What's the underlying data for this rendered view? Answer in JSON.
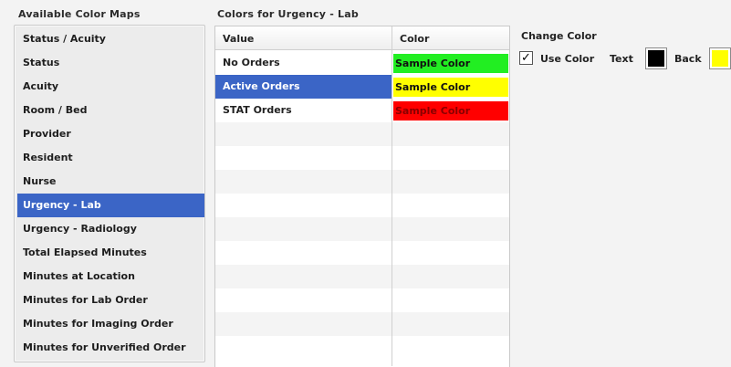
{
  "left_panel": {
    "title": "Available Color Maps",
    "items": [
      {
        "label": "Status / Acuity"
      },
      {
        "label": "Status"
      },
      {
        "label": "Acuity"
      },
      {
        "label": "Room / Bed"
      },
      {
        "label": "Provider"
      },
      {
        "label": "Resident"
      },
      {
        "label": "Nurse"
      },
      {
        "label": "Urgency - Lab"
      },
      {
        "label": "Urgency - Radiology"
      },
      {
        "label": "Total Elapsed Minutes"
      },
      {
        "label": "Minutes at Location"
      },
      {
        "label": "Minutes for Lab Order"
      },
      {
        "label": "Minutes for Imaging Order"
      },
      {
        "label": "Minutes for Unverified Order"
      }
    ],
    "selected_index": 7
  },
  "grid": {
    "title": "Colors for Urgency - Lab",
    "headers": {
      "value": "Value",
      "color": "Color"
    },
    "rows": [
      {
        "value": "No Orders",
        "sample": "Sample Color",
        "bg": "#22ee22",
        "fg": "#111111"
      },
      {
        "value": "Active Orders",
        "sample": "Sample Color",
        "bg": "#ffff00",
        "fg": "#111111"
      },
      {
        "value": "STAT Orders",
        "sample": "Sample Color",
        "bg": "#ff0000",
        "fg": "#8a0000"
      }
    ],
    "selected_row": 1
  },
  "change_color": {
    "title": "Change Color",
    "use_color_label": "Use Color",
    "use_color_checked": "✓",
    "text_label": "Text",
    "back_label": "Back",
    "text_color": "#000000",
    "back_color": "#ffff00"
  },
  "colors": {
    "selection": "#3b65c6"
  }
}
